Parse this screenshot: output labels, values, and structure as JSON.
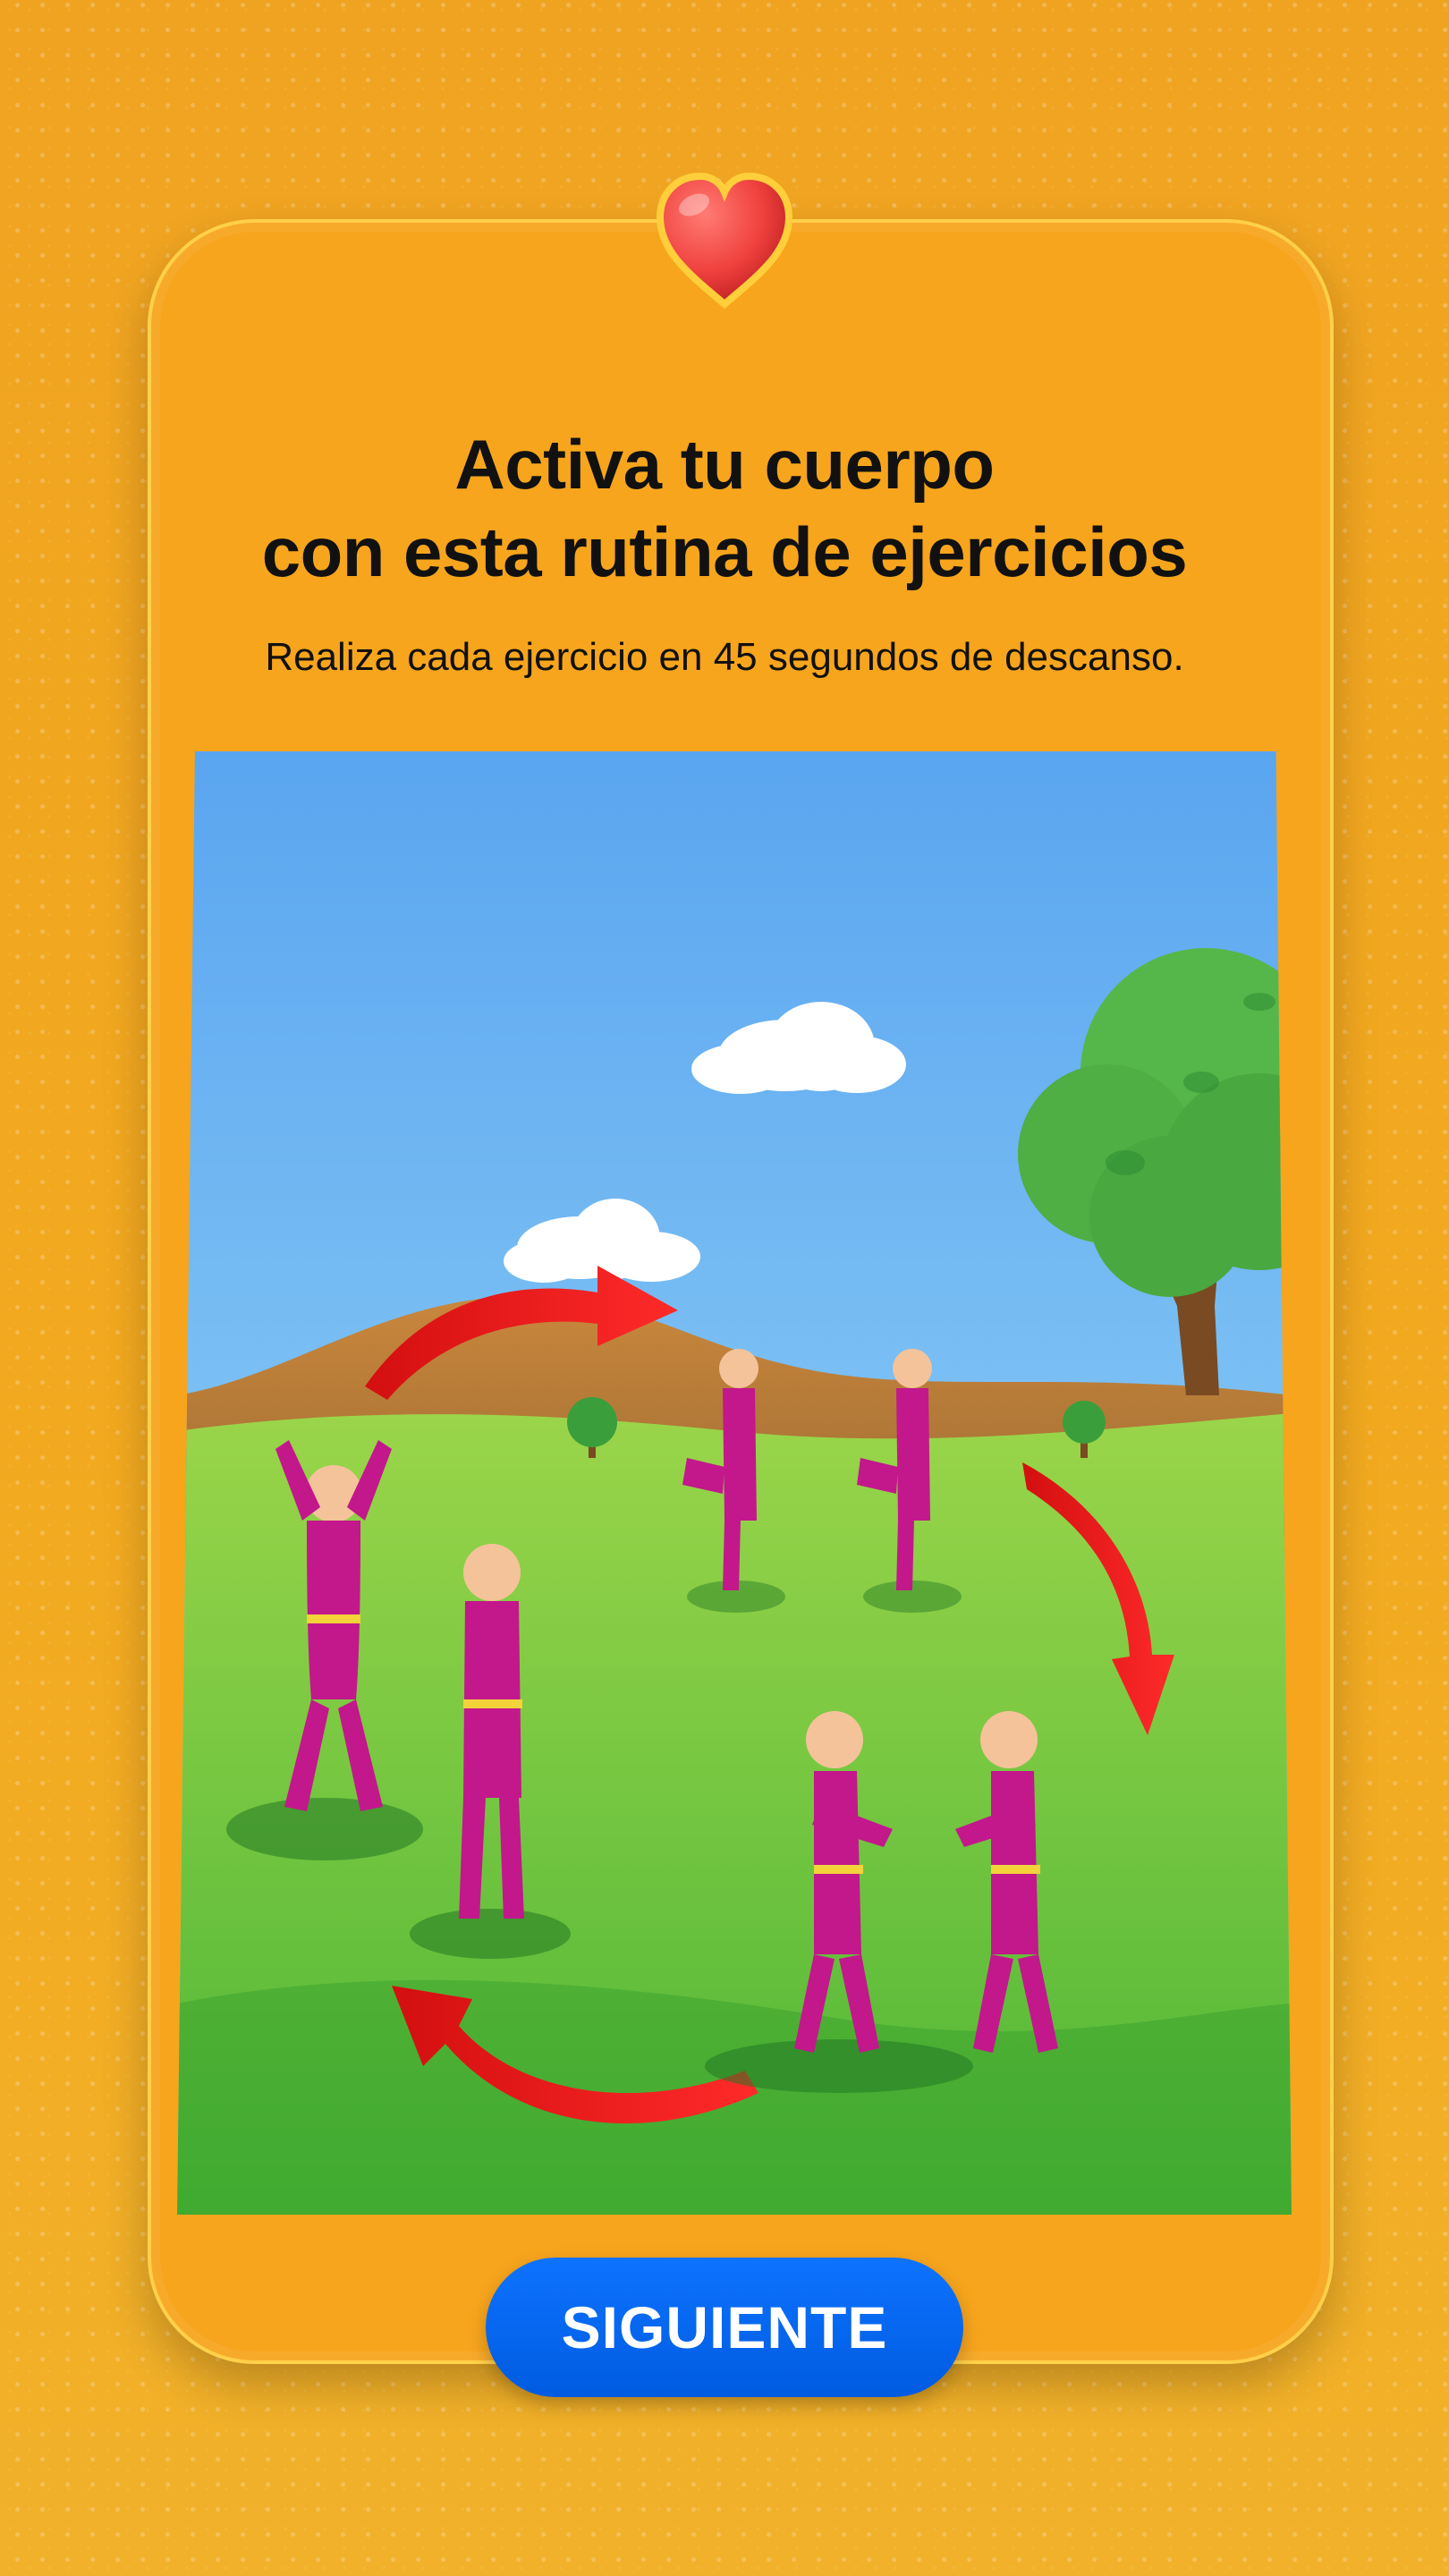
{
  "header": {
    "title": "Activa tu cuerpo\ncon esta rutina de ejercicios",
    "subtitle": "Realiza cada ejercicio en 45 segundos de descanso."
  },
  "actions": {
    "next_label": "SIGUIENTE"
  },
  "icons": {
    "heart": "heart-icon"
  },
  "colors": {
    "accent": "#0063f5",
    "card": "#f7a51d",
    "background": "#f2a923"
  }
}
